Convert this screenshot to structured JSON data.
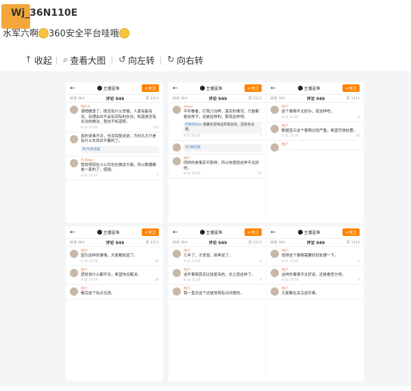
{
  "post": {
    "username": "Wj_36N110E",
    "text_1": "水军六啊",
    "text_2": "360安全平台哇哦"
  },
  "toolbar": {
    "collapse": "收起",
    "view_large": "查看大图",
    "rotate_left": "向左转",
    "rotate_right": "向右转"
  },
  "phones": [
    {
      "brand": "主播鲨鱼",
      "follow": "+关注",
      "tabs": [
        "转发 364",
        "评论 949",
        "赞 3313"
      ],
      "comments": [
        {
          "name": "用户A",
          "body": "请稍微查了，既没有什么举报，人家有能有没，有理由并不会有实际的办法，知道是否有合法的做法，我也不知道呢。",
          "reply_name": "",
          "reply": "",
          "time": "4-11 11:52",
          "likes": "152"
        },
        {
          "name": "",
          "body": "真的说事不对，也没回复说说，为何大大只是有什么东西并不要的了。",
          "reply_name": "共75条回复",
          "reply": "",
          "time": "",
          "likes": ""
        },
        {
          "name": "TkWigs",
          "body": "我觉得现在小公司也在做这方面，所以数据都是一家的了，感谢。",
          "reply_name": "",
          "reply": "",
          "time": "4-11 11:53",
          "likes": "7"
        }
      ]
    },
    {
      "brand": "主播鲨鱼",
      "follow": "+关注",
      "tabs": [
        "转发 364",
        "评论 949",
        "赞 3313"
      ],
      "comments": [
        {
          "name": "shine",
          "body": "平时看看，打我几句啊，真实的情况，只是都是这样子，说是这样的，那就这样吧。",
          "reply_name": "你家的Hex",
          "reply": "我确实觉得这样挺好的，回复有点慢。",
          "time": "4-11 12:50",
          "likes": "7"
        },
        {
          "name": "",
          "body": "",
          "reply_name": "共3条回复",
          "reply": "",
          "time": "",
          "likes": ""
        },
        {
          "name": "用户",
          "body": "同样的是事实不那样，所以你感觉这样不太好吧。",
          "reply_name": "",
          "reply": "",
          "time": "4-11 13:10",
          "likes": "67"
        }
      ]
    },
    {
      "brand": "主播鲨鱼",
      "follow": "+关注",
      "tabs": [
        "转发 364",
        "评论 949",
        "赞 3313"
      ],
      "comments": [
        {
          "name": "用户",
          "body": "这个事情不太好办，就这样吧。",
          "reply_name": "",
          "reply": "",
          "time": "4-11 13:20",
          "likes": "4"
        },
        {
          "name": "用户",
          "body": "数据显示这个事情比较严重，希望尽快处理。",
          "reply_name": "",
          "reply": "",
          "time": "4-11 12:30",
          "likes": "43"
        },
        {
          "name": "用户",
          "body": "",
          "reply_name": "",
          "reply": "",
          "time": "",
          "likes": ""
        }
      ]
    },
    {
      "brand": "主播鲨鱼",
      "follow": "+关注",
      "tabs": [
        "转发 364",
        "评论 949",
        "赞 3313"
      ],
      "comments": [
        {
          "name": "用户",
          "body": "因为这样的事情，大家都知道了。",
          "reply_name": "",
          "reply": "",
          "time": "4-11 11:53",
          "likes": "10"
        },
        {
          "name": "用户",
          "body": "感觉说什么都不对，希望快点解决。",
          "reply_name": "",
          "reply": "",
          "time": "4-11 13:10",
          "likes": "24"
        },
        {
          "name": "用户",
          "body": "看完这个有点无语。",
          "reply_name": "",
          "reply": "",
          "time": "",
          "likes": ""
        }
      ]
    },
    {
      "brand": "主播鲨鱼",
      "follow": "+关注",
      "tabs": [
        "转发 364",
        "评论 949",
        "赞 3313"
      ],
      "comments": [
        {
          "name": "用户",
          "body": "几年了，才发现，别再说了。",
          "reply_name": "",
          "reply": "",
          "time": "4-11 13:20",
          "likes": "4"
        },
        {
          "name": "用户",
          "body": "这件事情其实比较复杂的，总之就这样了。",
          "reply_name": "",
          "reply": "",
          "time": "4-11 11:25",
          "likes": "4"
        },
        {
          "name": "用户",
          "body": "我一直对这个还是觉得有点问题的。",
          "reply_name": "",
          "reply": "",
          "time": "",
          "likes": ""
        }
      ]
    },
    {
      "brand": "主播鲨鱼",
      "follow": "+关注",
      "tabs": [
        "转发 364",
        "评论 949",
        "赞 3313"
      ],
      "comments": [
        {
          "name": "用户",
          "body": "觉得这个事情需要好好处理一下。",
          "reply_name": "",
          "reply": "",
          "time": "4-11 13:20",
          "likes": "5"
        },
        {
          "name": "用户",
          "body": "这样的事情不太好说，还是看官方吧。",
          "reply_name": "",
          "reply": "",
          "time": "4-11 12:10",
          "likes": "3"
        },
        {
          "name": "用户",
          "body": "大家都在关注这件事。",
          "reply_name": "",
          "reply": "",
          "time": "",
          "likes": ""
        }
      ]
    }
  ]
}
